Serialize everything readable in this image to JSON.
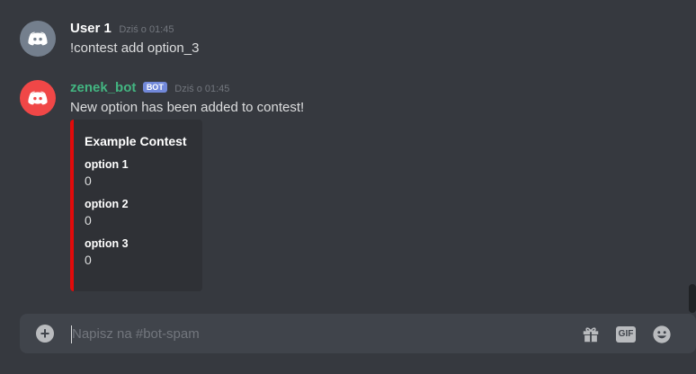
{
  "messages": [
    {
      "username": "User 1",
      "username_color": "#ffffff",
      "avatar_color": "#747f8d",
      "avatar_icon": "discord-logo-icon",
      "timestamp": "Dziś o 01:45",
      "content": "!contest add option_3"
    },
    {
      "username": "zenek_bot",
      "username_color": "#43b581",
      "bot_tag": "BOT",
      "avatar_color": "#f04747",
      "avatar_icon": "discord-logo-icon",
      "timestamp": "Dziś o 01:45",
      "content": "New option has been added to contest!",
      "embed": {
        "accent_color": "#e20a0a",
        "title": "Example Contest",
        "fields": [
          {
            "name": "option 1",
            "value": "0"
          },
          {
            "name": "option 2",
            "value": "0"
          },
          {
            "name": "option 3",
            "value": "0"
          }
        ]
      }
    }
  ],
  "composer": {
    "placeholder": "Napisz na #bot-spam",
    "attach_icon": "plus-circle-icon",
    "gift_icon": "gift-icon",
    "gif_label": "GIF",
    "emoji_icon": "emoji-smile-icon"
  }
}
